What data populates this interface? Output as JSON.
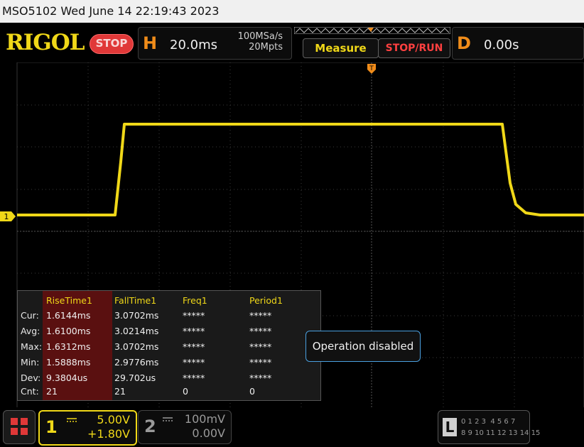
{
  "status": {
    "text": "MSO5102  Wed June 14 22:19:43 2023"
  },
  "header": {
    "logo": "RIGOL",
    "run_state": "STOP",
    "h_letter": "H",
    "timebase": "20.0ms",
    "sample_rate": "100MSa/s",
    "memory_depth": "20Mpts",
    "measure_label": "Measure",
    "stoprun_label": "STOP/RUN",
    "d_letter": "D",
    "delay": "0.00s"
  },
  "colors": {
    "channel1": "#f0d818",
    "trigger": "#f08c1a",
    "stop": "#e03838",
    "grid": "#3a3a3a"
  },
  "measurements": {
    "headers": [
      "RiseTime1",
      "FallTime1",
      "Freq1",
      "Period1"
    ],
    "rows": [
      {
        "label": "Cur:",
        "values": [
          "1.6144ms",
          "3.0702ms",
          "*****",
          "*****"
        ]
      },
      {
        "label": "Avg:",
        "values": [
          "1.6100ms",
          "3.0214ms",
          "*****",
          "*****"
        ]
      },
      {
        "label": "Max:",
        "values": [
          "1.6312ms",
          "3.0702ms",
          "*****",
          "*****"
        ]
      },
      {
        "label": "Min:",
        "values": [
          "1.5888ms",
          "2.9776ms",
          "*****",
          "*****"
        ]
      },
      {
        "label": "Dev:",
        "values": [
          "9.3804us",
          "29.702us",
          "*****",
          "*****"
        ]
      },
      {
        "label": "Cnt:",
        "values": [
          "21",
          "21",
          "0",
          "0"
        ]
      }
    ]
  },
  "popup": {
    "text": "Operation disabled"
  },
  "channel_marker": "1",
  "ch1": {
    "num": "1",
    "scale": "5.00V",
    "offset": "+1.80V"
  },
  "ch2": {
    "num": "2",
    "scale": "100mV",
    "offset": "0.00V"
  },
  "logic": {
    "letter": "L",
    "row1": "0 1 2 3  4 5 6 7",
    "row2": "8 9 10 11 12 13 14 15"
  },
  "icons": [
    "menu-grid-icon",
    "trigger-position-icon",
    "channel-marker-icon",
    "dc-coupling-icon"
  ]
}
